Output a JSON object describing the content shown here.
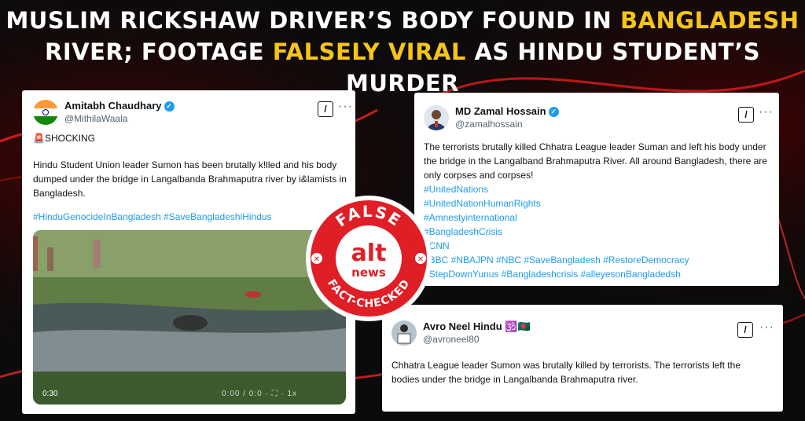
{
  "headline": {
    "line1_a": "MUSLIM RICKSHAW DRIVER’S BODY FOUND IN ",
    "line1_b": "BANGLADESH",
    "line2_a": "RIVER; FOOTAGE ",
    "line2_b": "FALSELY VIRAL",
    "line2_c": " AS HINDU STUDENT’S MURDER"
  },
  "colors": {
    "highlight": "#f5c518",
    "badge_red": "#e01e26",
    "link_blue": "#1d9bf0"
  },
  "tweet1": {
    "name": "Amitabh Chaudhary",
    "handle": "@MithilaWaala",
    "alert": "🚨SHOCKING",
    "body": "Hindu Student Union leader Sumon has been brutally k!lled and his body dumped under the bridge in Langalbanda Brahmaputra river by i&lamists in Bangladesh.",
    "hashtags": "#HinduGenocideInBangladesh #SaveBangladeshiHindus",
    "video_time": "0:30",
    "video_controls": "0:00 / 0:0 · ⛶ · 1x"
  },
  "tweet2": {
    "name": "MD Zamal Hossain",
    "handle": "@zamalhossain",
    "body": "The terrorists brutally killed Chhatra League leader Suman and left his body under the bridge in the Langalband Brahmaputra River. All around Bangladesh, there are only corpses and corpses!",
    "tags": [
      "#UnitedNations",
      "#UnitedNationHumanRights",
      "#Amnestyinternational",
      "#BangladeshCrisis",
      "#CNN",
      "#BBC #NBAJPN #NBC #SaveBangladesh #RestoreDemocracy",
      "#StepDownYunus #Bangladeshcrisis #alleyesonBangladedsh"
    ]
  },
  "tweet3": {
    "name": "Avro Neel Hindu",
    "emoji": "🕉️🇧🇩",
    "handle": "@avroneel80",
    "body": "Chhatra League leader Sumon was brutally killed by terrorists. The terrorists left the bodies under the bridge in Langalbanda Brahmaputra river."
  },
  "badge": {
    "top": "FALSE",
    "logo_top": "alt",
    "logo_bottom": "news",
    "bottom": "FACT-CHECKED"
  },
  "icons": {
    "grok": "grok-icon",
    "more": "more-options-icon",
    "verified": "verified-badge-icon"
  }
}
